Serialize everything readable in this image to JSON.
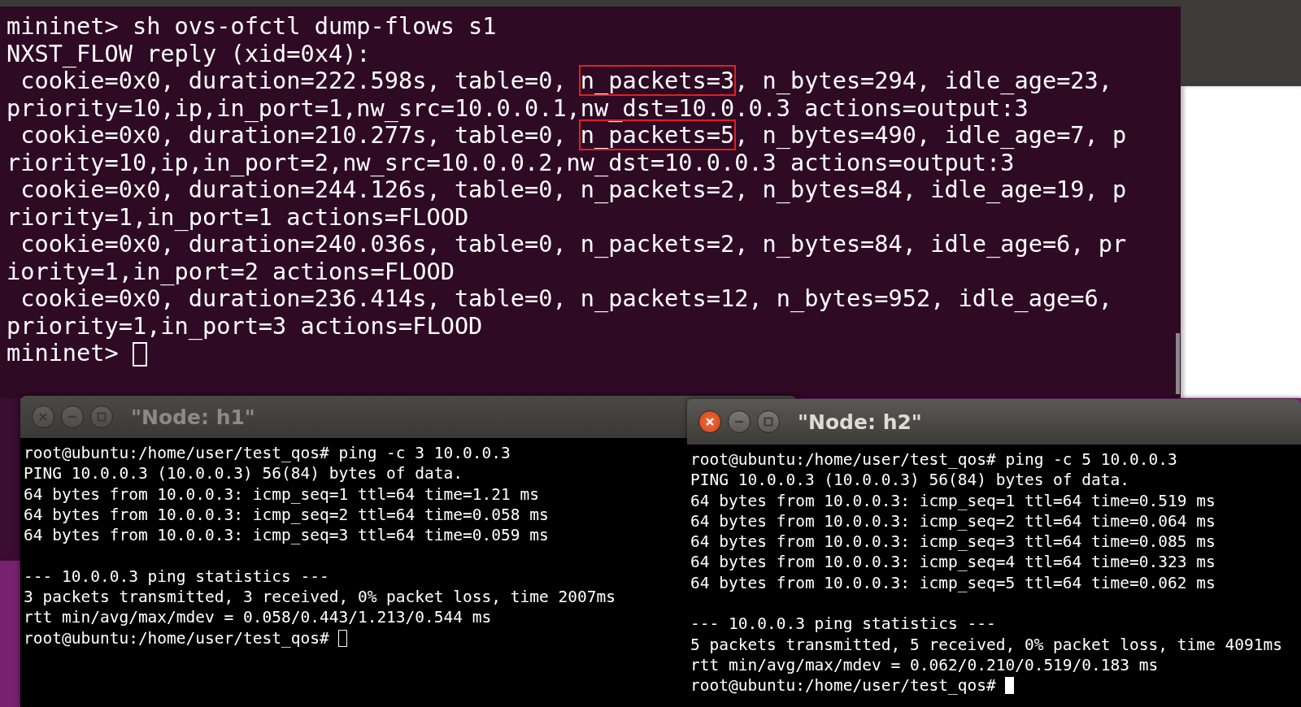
{
  "main_terminal": {
    "lines": [
      {
        "segments": [
          {
            "text": "mininet> sh ovs-ofctl dump-flows s1",
            "highlighted": false
          }
        ]
      },
      {
        "segments": [
          {
            "text": "NXST_FLOW reply (xid=0x4):",
            "highlighted": false
          }
        ]
      },
      {
        "segments": [
          {
            "text": " cookie=0x0, duration=222.598s, table=0, ",
            "highlighted": false
          },
          {
            "text": "n_packets=3",
            "highlighted": true
          },
          {
            "text": ", n_bytes=294, idle_age=23,",
            "highlighted": false
          }
        ]
      },
      {
        "segments": [
          {
            "text": "priority=10,ip,in_port=1,nw_src=10.0.0.1,nw_dst=10.0.0.3 actions=output:3",
            "highlighted": false
          }
        ]
      },
      {
        "segments": [
          {
            "text": " cookie=0x0, duration=210.277s, table=0, ",
            "highlighted": false
          },
          {
            "text": "n_packets=5",
            "highlighted": true
          },
          {
            "text": ", n_bytes=490, idle_age=7, p",
            "highlighted": false
          }
        ]
      },
      {
        "segments": [
          {
            "text": "riority=10,ip,in_port=2,nw_src=10.0.0.2,nw_dst=10.0.0.3 actions=output:3",
            "highlighted": false
          }
        ]
      },
      {
        "segments": [
          {
            "text": " cookie=0x0, duration=244.126s, table=0, n_packets=2, n_bytes=84, idle_age=19, p",
            "highlighted": false
          }
        ]
      },
      {
        "segments": [
          {
            "text": "riority=1,in_port=1 actions=FLOOD",
            "highlighted": false
          }
        ]
      },
      {
        "segments": [
          {
            "text": " cookie=0x0, duration=240.036s, table=0, n_packets=2, n_bytes=84, idle_age=6, pr",
            "highlighted": false
          }
        ]
      },
      {
        "segments": [
          {
            "text": "iority=1,in_port=2 actions=FLOOD",
            "highlighted": false
          }
        ]
      },
      {
        "segments": [
          {
            "text": " cookie=0x0, duration=236.414s, table=0, n_packets=12, n_bytes=952, idle_age=6,",
            "highlighted": false
          }
        ]
      },
      {
        "segments": [
          {
            "text": "priority=1,in_port=3 actions=FLOOD",
            "highlighted": false
          }
        ]
      }
    ],
    "prompt": "mininet> "
  },
  "windows": [
    {
      "title": "\"Node: h1\"",
      "active": false,
      "lines": [
        {
          "kind": "text",
          "text": "root@ubuntu:/home/user/test_qos# ping -c 3 10.0.0.3"
        },
        {
          "kind": "text",
          "text": "PING 10.0.0.3 (10.0.0.3) 56(84) bytes of data."
        },
        {
          "kind": "text",
          "text": "64 bytes from 10.0.0.3: icmp_seq=1 ttl=64 time=1.21 ms"
        },
        {
          "kind": "text",
          "text": "64 bytes from 10.0.0.3: icmp_seq=2 ttl=64 time=0.058 ms"
        },
        {
          "kind": "text",
          "text": "64 bytes from 10.0.0.3: icmp_seq=3 ttl=64 time=0.059 ms"
        },
        {
          "kind": "blank"
        },
        {
          "kind": "text",
          "text": "--- 10.0.0.3 ping statistics ---"
        },
        {
          "kind": "text",
          "text": "3 packets transmitted, 3 received, 0% packet loss, time 2007ms"
        },
        {
          "kind": "text",
          "text": "rtt min/avg/max/mdev = 0.058/0.443/1.213/0.544 ms"
        }
      ],
      "prompt": "root@ubuntu:/home/user/test_qos# "
    },
    {
      "title": "\"Node: h2\"",
      "active": true,
      "lines": [
        {
          "kind": "text",
          "text": "root@ubuntu:/home/user/test_qos# ping -c 5 10.0.0.3"
        },
        {
          "kind": "text",
          "text": "PING 10.0.0.3 (10.0.0.3) 56(84) bytes of data."
        },
        {
          "kind": "text",
          "text": "64 bytes from 10.0.0.3: icmp_seq=1 ttl=64 time=0.519 ms"
        },
        {
          "kind": "text",
          "text": "64 bytes from 10.0.0.3: icmp_seq=2 ttl=64 time=0.064 ms"
        },
        {
          "kind": "text",
          "text": "64 bytes from 10.0.0.3: icmp_seq=3 ttl=64 time=0.085 ms"
        },
        {
          "kind": "text",
          "text": "64 bytes from 10.0.0.3: icmp_seq=4 ttl=64 time=0.323 ms"
        },
        {
          "kind": "text",
          "text": "64 bytes from 10.0.0.3: icmp_seq=5 ttl=64 time=0.062 ms"
        },
        {
          "kind": "blank"
        },
        {
          "kind": "text",
          "text": "--- 10.0.0.3 ping statistics ---"
        },
        {
          "kind": "text",
          "text": "5 packets transmitted, 5 received, 0% packet loss, time 4091ms"
        },
        {
          "kind": "text",
          "text": "rtt min/avg/max/mdev = 0.062/0.210/0.519/0.183 ms"
        }
      ],
      "prompt": "root@ubuntu:/home/user/test_qos# "
    }
  ]
}
